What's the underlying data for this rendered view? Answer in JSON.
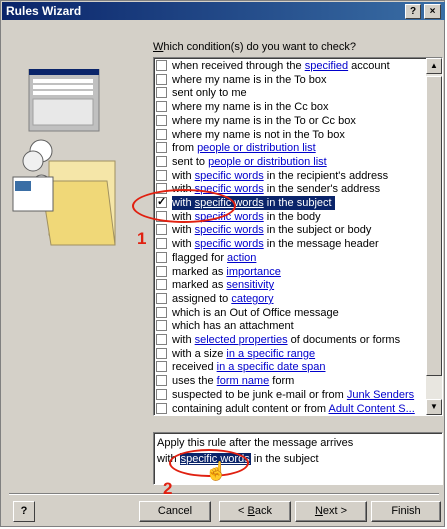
{
  "window": {
    "title": "Rules Wizard"
  },
  "question": {
    "prefix": "",
    "accel": "W",
    "rest": "hich condition(s) do you want to check?"
  },
  "conditions": [
    {
      "pre": "when received through the ",
      "link": "specified",
      "post": " account",
      "checked": false,
      "selected": false
    },
    {
      "pre": "where my name is in the To box",
      "link": "",
      "post": "",
      "checked": false,
      "selected": false
    },
    {
      "pre": "sent only to me",
      "link": "",
      "post": "",
      "checked": false,
      "selected": false
    },
    {
      "pre": "where my name is in the Cc box",
      "link": "",
      "post": "",
      "checked": false,
      "selected": false
    },
    {
      "pre": "where my name is in the To or Cc box",
      "link": "",
      "post": "",
      "checked": false,
      "selected": false
    },
    {
      "pre": "where my name is not in the To box",
      "link": "",
      "post": "",
      "checked": false,
      "selected": false
    },
    {
      "pre": "from ",
      "link": "people or distribution list",
      "post": "",
      "checked": false,
      "selected": false
    },
    {
      "pre": "sent to ",
      "link": "people or distribution list",
      "post": "",
      "checked": false,
      "selected": false
    },
    {
      "pre": "with ",
      "link": "specific words",
      "post": " in the recipient's address",
      "checked": false,
      "selected": false
    },
    {
      "pre": "with ",
      "link": "specific words",
      "post": " in the sender's address",
      "checked": false,
      "selected": false
    },
    {
      "pre": "with ",
      "link": "specific words",
      "post": " in the subject",
      "checked": true,
      "selected": true
    },
    {
      "pre": "with ",
      "link": "specific words",
      "post": " in the body",
      "checked": false,
      "selected": false
    },
    {
      "pre": "with ",
      "link": "specific words",
      "post": " in the subject or body",
      "checked": false,
      "selected": false
    },
    {
      "pre": "with ",
      "link": "specific words",
      "post": " in the message header",
      "checked": false,
      "selected": false
    },
    {
      "pre": "flagged for ",
      "link": "action",
      "post": "",
      "checked": false,
      "selected": false
    },
    {
      "pre": "marked as ",
      "link": "importance",
      "post": "",
      "checked": false,
      "selected": false
    },
    {
      "pre": "marked as ",
      "link": "sensitivity",
      "post": "",
      "checked": false,
      "selected": false
    },
    {
      "pre": "assigned to ",
      "link": "category",
      "post": "",
      "checked": false,
      "selected": false
    },
    {
      "pre": "which is an Out of Office message",
      "link": "",
      "post": "",
      "checked": false,
      "selected": false
    },
    {
      "pre": "which has an attachment",
      "link": "",
      "post": "",
      "checked": false,
      "selected": false
    },
    {
      "pre": "with ",
      "link": "selected properties",
      "post": " of documents or forms",
      "checked": false,
      "selected": false
    },
    {
      "pre": "with a size ",
      "link": "in a specific range",
      "post": "",
      "checked": false,
      "selected": false
    },
    {
      "pre": "received ",
      "link": "in a specific date span",
      "post": "",
      "checked": false,
      "selected": false
    },
    {
      "pre": "uses the ",
      "link": "form name",
      "post": " form",
      "checked": false,
      "selected": false
    },
    {
      "pre": "suspected to be junk e-mail or from ",
      "link": "Junk Senders",
      "post": "",
      "checked": false,
      "selected": false
    },
    {
      "pre": "containing adult content or from ",
      "link": "Adult Content S...",
      "post": "",
      "checked": false,
      "selected": false
    }
  ],
  "description": {
    "line1": "Apply this rule after the message arrives",
    "line2_pre": "with ",
    "line2_link": "specific words",
    "line2_post": " in the subject"
  },
  "annotations": {
    "num1": "1",
    "num2": "2",
    "color": "#e02010"
  },
  "buttons": {
    "help": "?",
    "cancel": "Cancel",
    "back_pre": "< ",
    "back_accel": "B",
    "back_rest": "ack",
    "next_accel": "N",
    "next_rest": "ext >",
    "finish": "Finish"
  },
  "icons": {
    "close": "×",
    "help_title": "?",
    "scroll_up": "▲",
    "scroll_down": "▼",
    "hand": "☝"
  }
}
